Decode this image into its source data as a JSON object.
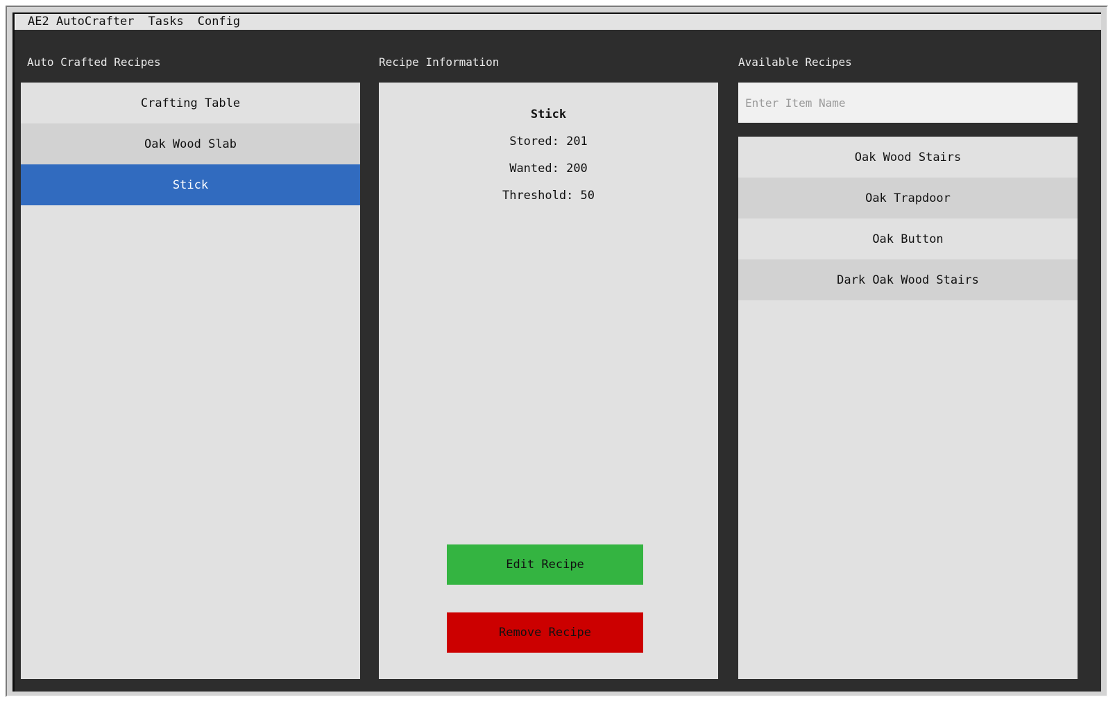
{
  "menu": {
    "items": [
      "AE2 AutoCrafter",
      "Tasks",
      "Config"
    ]
  },
  "auto_crafted": {
    "title": "Auto Crafted Recipes",
    "items": [
      "Crafting Table",
      "Oak Wood Slab",
      "Stick"
    ],
    "selected": "Stick"
  },
  "recipe_info": {
    "title": "Recipe Information",
    "name": "Stick",
    "stored": "Stored: 201",
    "wanted": "Wanted: 200",
    "threshold": "Threshold: 50",
    "edit_label": "Edit Recipe",
    "remove_label": "Remove Recipe"
  },
  "available": {
    "title": "Available Recipes",
    "search_placeholder": "Enter Item Name",
    "search_value": "",
    "items": [
      "Oak Wood Stairs",
      "Oak Trapdoor",
      "Oak Button",
      "Dark Oak Wood Stairs"
    ]
  },
  "colors": {
    "background": "#2d2d2d",
    "panel": "#e1e1e1",
    "selected": "#316bbf",
    "edit_button": "#34b441",
    "remove_button": "#cc0000"
  }
}
